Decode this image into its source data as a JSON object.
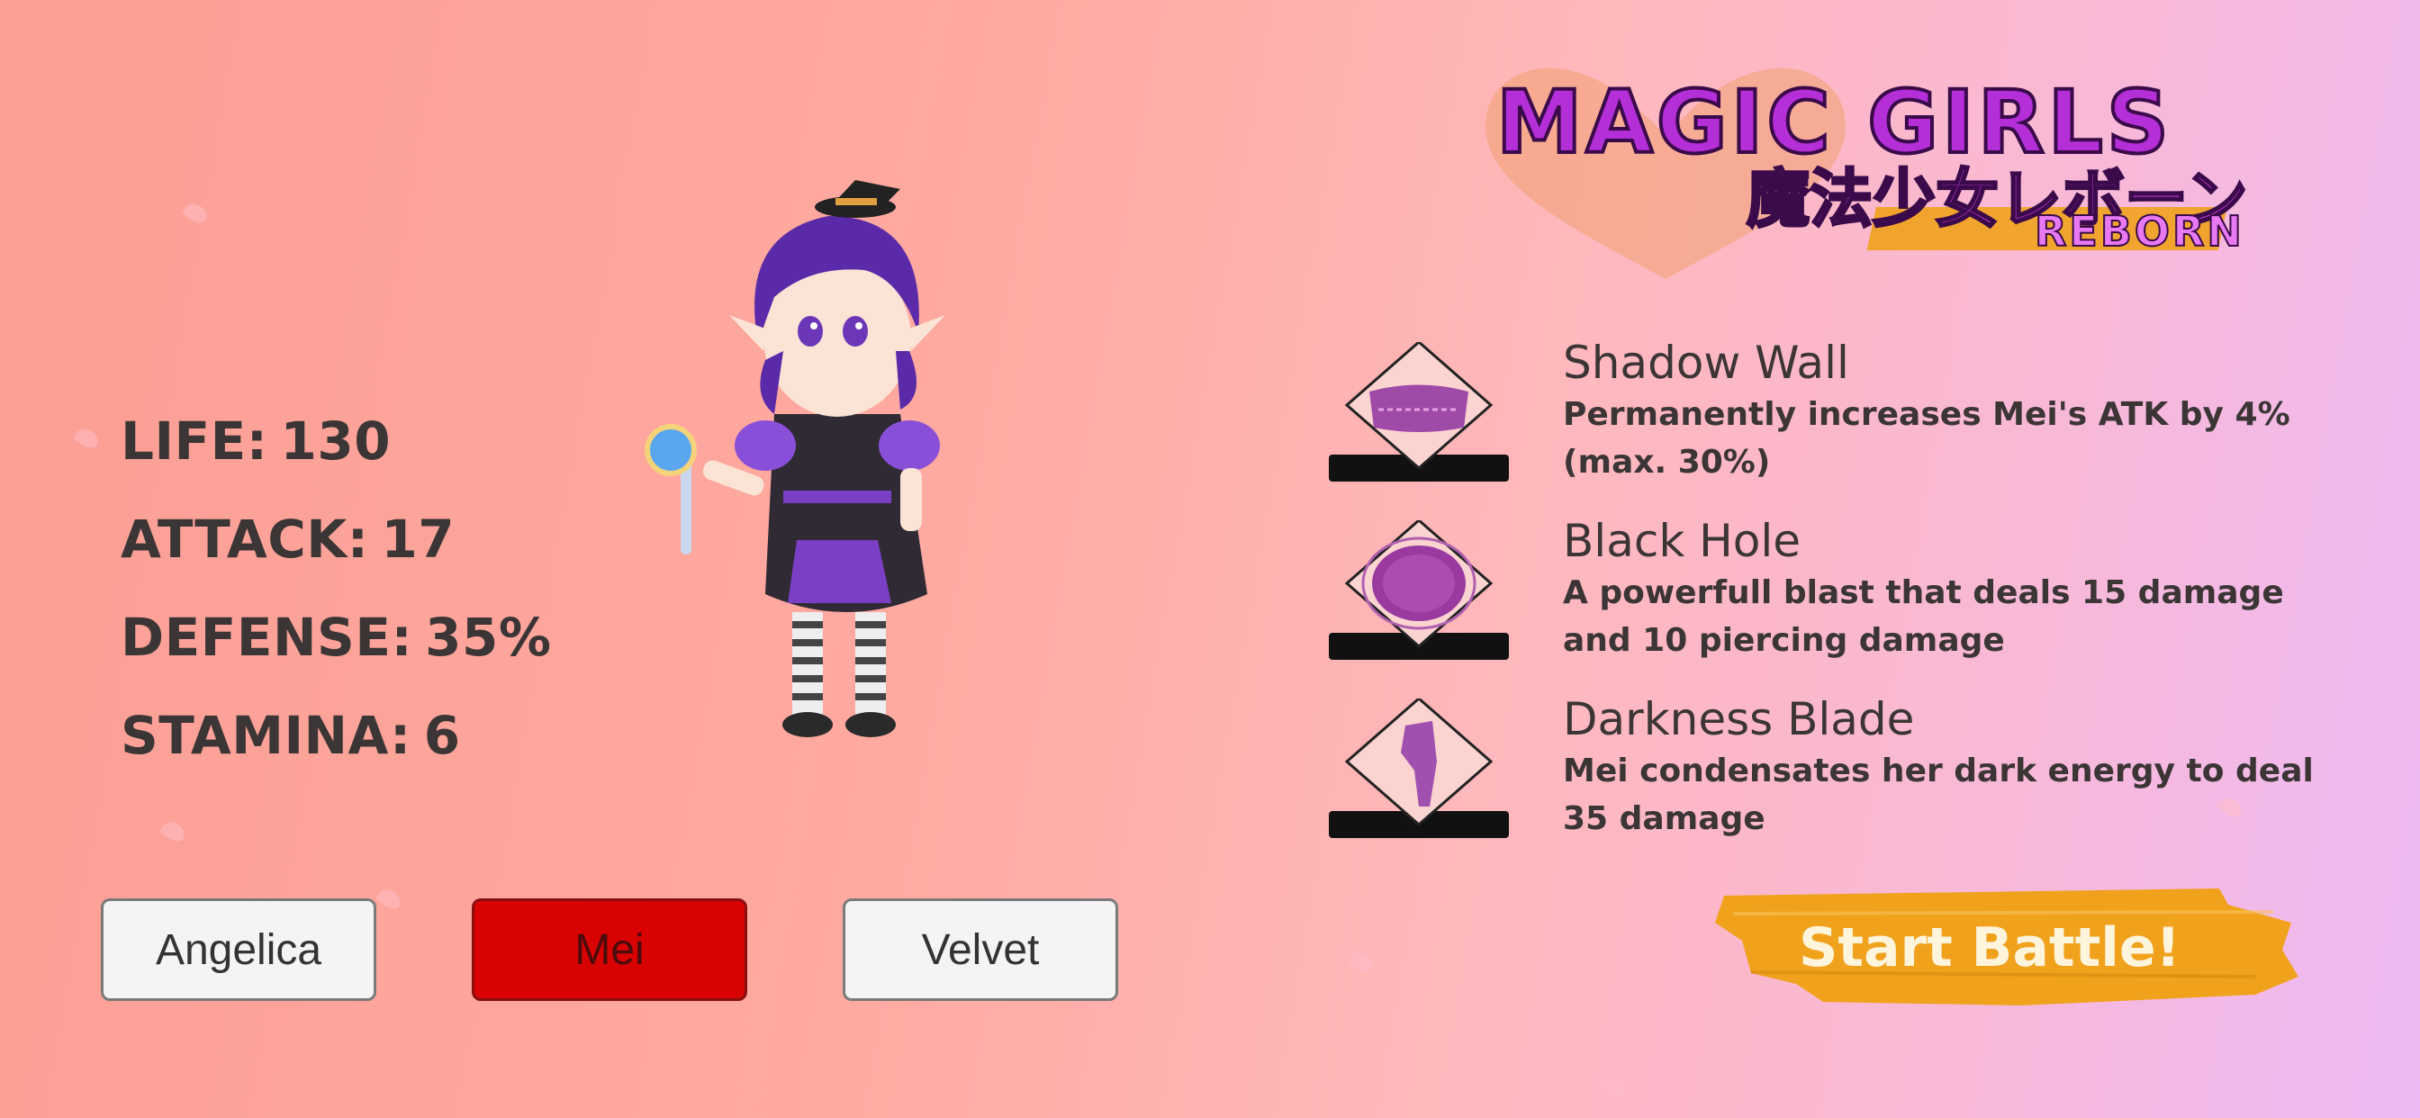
{
  "logo": {
    "title": "MAGIC GIRLS",
    "subtitle_jp": "魔法少女レボーン",
    "tagline": "REBORN"
  },
  "stats": [
    {
      "label": "LIFE:",
      "value": "130"
    },
    {
      "label": "ATTACK:",
      "value": "17"
    },
    {
      "label": "DEFENSE:",
      "value": "35%"
    },
    {
      "label": "STAMINA:",
      "value": "6"
    }
  ],
  "character": {
    "name": "Mei",
    "icon": "witch-girl-character"
  },
  "characters": [
    {
      "label": "Angelica",
      "selected": false
    },
    {
      "label": "Mei",
      "selected": true
    },
    {
      "label": "Velvet",
      "selected": false
    }
  ],
  "skills": [
    {
      "name": "Shadow Wall",
      "description": "Permanently increases Mei's ATK by 4% (max. 30%)",
      "icon": "shadow-wall-icon"
    },
    {
      "name": "Black Hole",
      "description": "A powerfull blast that deals 15 damage and 10 piercing damage",
      "icon": "black-hole-icon"
    },
    {
      "name": "Darkness Blade",
      "description": "Mei condensates her dark energy to deal 35 damage",
      "icon": "darkness-blade-icon"
    }
  ],
  "start_button": {
    "label": "Start Battle!"
  },
  "colors": {
    "selected": "#d90202",
    "accent_orange": "#f0a21c",
    "logo_purple": "#b52fd8",
    "text": "#3b3535"
  }
}
